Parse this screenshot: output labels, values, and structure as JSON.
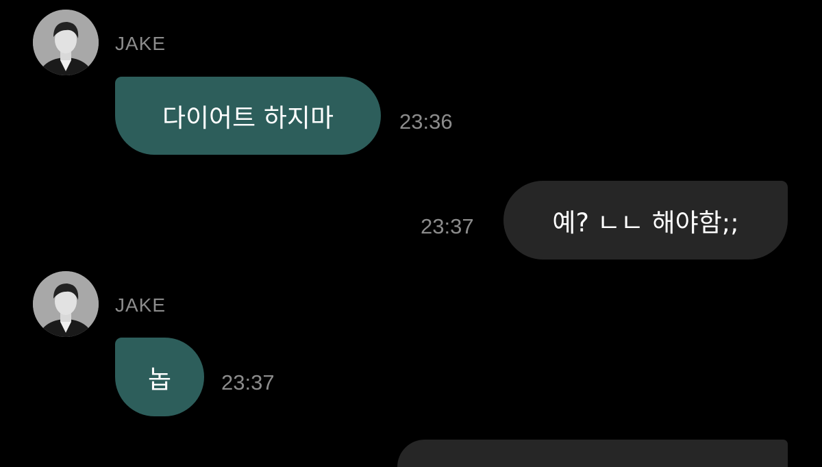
{
  "chat": {
    "messages": [
      {
        "sender": "JAKE",
        "text": "다이어트 하지마",
        "time": "23:36",
        "direction": "incoming",
        "avatar_icon": "profile-photo"
      },
      {
        "text": "예? ㄴㄴ 해야함;;",
        "time": "23:37",
        "direction": "outgoing"
      },
      {
        "sender": "JAKE",
        "text": "놉",
        "time": "23:37",
        "direction": "incoming",
        "avatar_icon": "profile-photo"
      }
    ]
  },
  "colors": {
    "background": "#000000",
    "incoming_bubble": "#2d5e5b",
    "outgoing_bubble": "#262626",
    "secondary_text": "#8c8c8c"
  }
}
